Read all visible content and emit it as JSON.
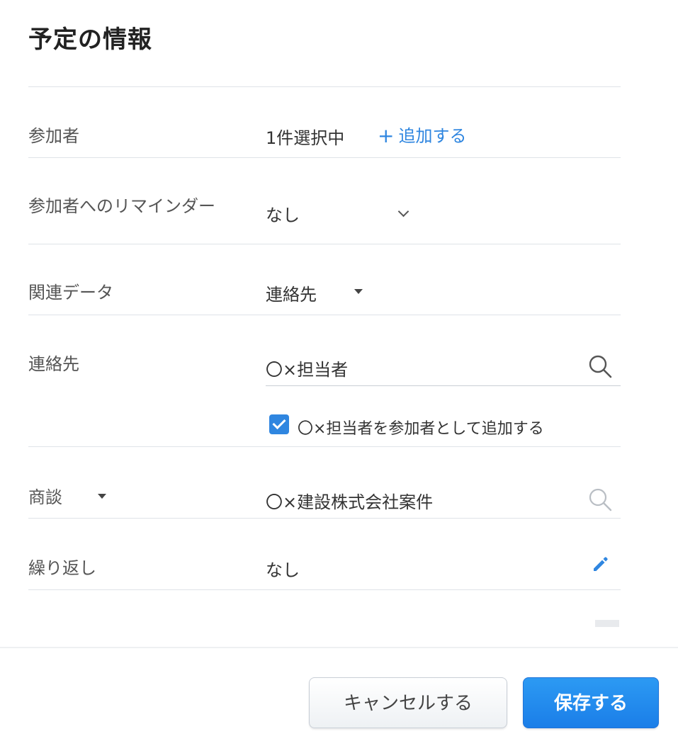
{
  "dialog": {
    "title": "予定の情報"
  },
  "fields": {
    "participants": {
      "label": "参加者",
      "value": "1件選択中",
      "add_link": "追加する",
      "add_plus": "+"
    },
    "reminder": {
      "label": "参加者へのリマインダー",
      "value": "なし"
    },
    "related_data": {
      "label": "関連データ",
      "value": "連絡先"
    },
    "contact": {
      "label": "連絡先",
      "value": "〇×担当者",
      "checkbox_label": "〇×担当者を参加者として追加する",
      "checkbox_checked": true
    },
    "deal": {
      "label": "商談",
      "value": "〇×建設株式会社案件"
    },
    "repeat": {
      "label": "繰り返し",
      "value": "なし"
    }
  },
  "footer": {
    "cancel_label": "キャンセルする",
    "save_label": "保存する"
  },
  "icons": {
    "search": "search-icon",
    "pencil": "pencil-icon",
    "chevron": "chevron-down-icon",
    "caret": "caret-down-icon",
    "check": "check-icon"
  },
  "colors": {
    "accent": "#2f86e0",
    "save_button": "#1b7ee8",
    "divider": "#dfe3e8"
  }
}
